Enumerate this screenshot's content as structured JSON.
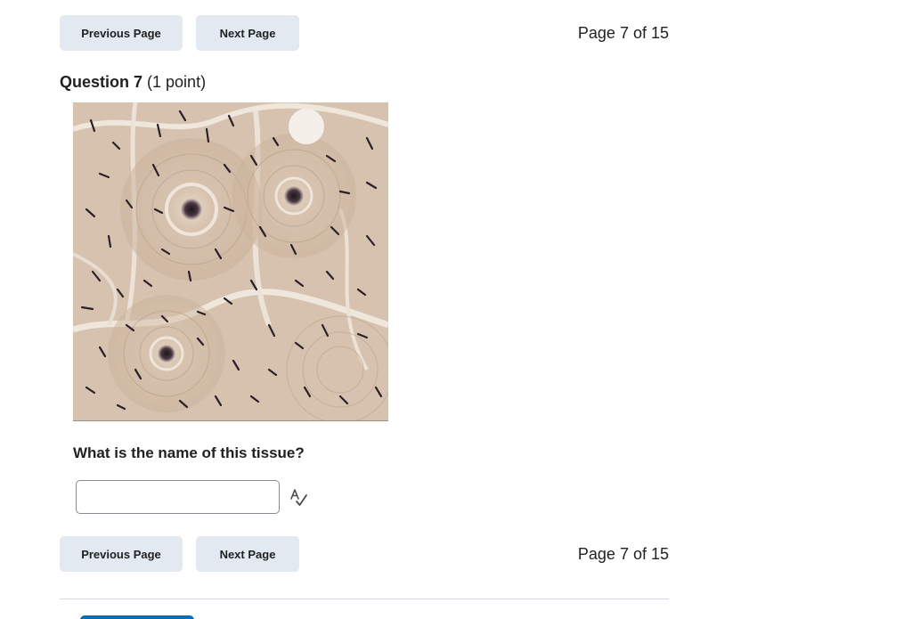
{
  "navigation": {
    "previous_label": "Previous Page",
    "next_label": "Next Page",
    "page_indicator": "Page 7 of 15"
  },
  "question": {
    "number_label": "Question 7",
    "points_label": "(1 point)",
    "prompt": "What is the name of this tissue?",
    "answer_value": "",
    "answer_placeholder": ""
  },
  "icons": {
    "spellcheck": "spellcheck-icon"
  },
  "colors": {
    "button_bg": "#e3e9f1",
    "text": "#202122",
    "input_border": "#868c96",
    "primary": "#006fbf",
    "tissue_bg": "#d9c6b4",
    "tissue_dark": "#2b2028"
  }
}
